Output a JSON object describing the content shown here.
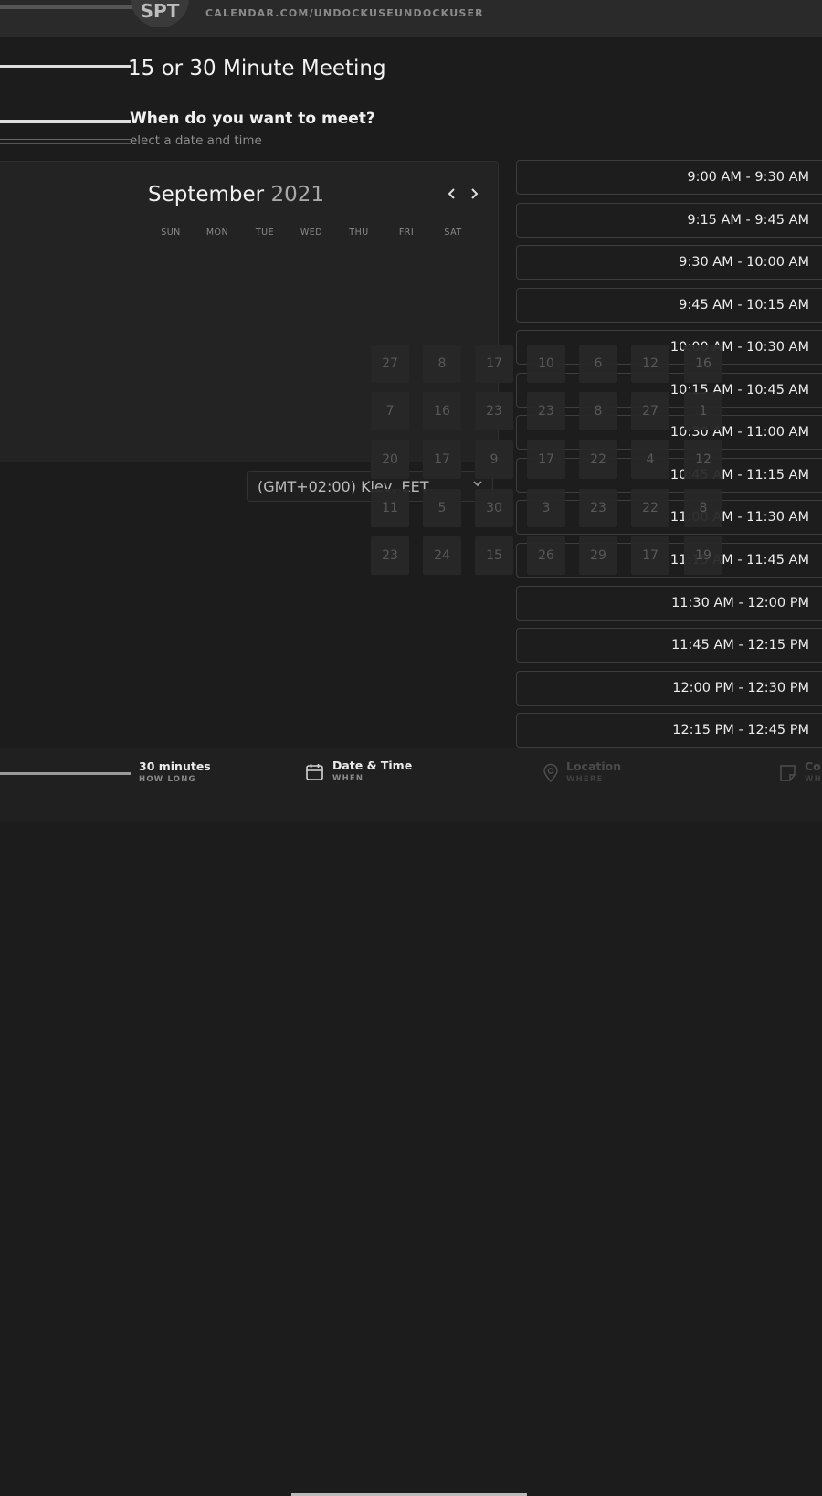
{
  "header": {
    "avatar_initials": "SPT",
    "calendar_url": "CALENDAR.COM/UNDOCKUSEUNDOCKUSER"
  },
  "meeting": {
    "title": "15 or 30 Minute Meeting"
  },
  "section": {
    "question": "When do you want to meet?",
    "subtitle": "elect a date and time"
  },
  "calendar": {
    "month": "September",
    "year": "2021",
    "prev_icon": "chevron-left-icon",
    "next_icon": "chevron-right-icon",
    "weekdays": [
      "SUN",
      "MON",
      "TUE",
      "WED",
      "THU",
      "FRI",
      "SAT"
    ],
    "days": [
      "27",
      "8",
      "17",
      "10",
      "6",
      "12",
      "16",
      "7",
      "16",
      "23",
      "23",
      "8",
      "27",
      "1",
      "20",
      "17",
      "9",
      "17",
      "22",
      "4",
      "12",
      "11",
      "5",
      "30",
      "3",
      "23",
      "22",
      "8",
      "23",
      "24",
      "15",
      "26",
      "29",
      "17",
      "19"
    ]
  },
  "timezone": {
    "label": "(GMT+02:00) Kiev, EET"
  },
  "time_slots": [
    "9:00 AM - 9:30 AM",
    "9:15 AM - 9:45 AM",
    "9:30 AM - 10:00 AM",
    "9:45 AM - 10:15 AM",
    "10:00 AM - 10:30 AM",
    "10:15 AM - 10:45 AM",
    "10:30 AM - 11:00 AM",
    "10:45 AM - 11:15 AM",
    "11:00 AM - 11:30 AM",
    "11:15 AM - 11:45 AM",
    "11:30 AM - 12:00 PM",
    "11:45 AM - 12:15 PM",
    "12:00 PM - 12:30 PM",
    "12:15 PM - 12:45 PM"
  ],
  "footer": {
    "duration": {
      "label": "30 minutes",
      "sub": "HOW LONG"
    },
    "datetime": {
      "label": "Date & Time",
      "sub": "WHEN",
      "icon": "calendar-icon"
    },
    "location": {
      "label": "Location",
      "sub": "WHERE",
      "icon": "location-pin-icon"
    },
    "confirm": {
      "label": "Co",
      "sub": "WH",
      "icon": "note-icon"
    }
  },
  "colors": {
    "background": "#1c1c1c",
    "panel": "#232323",
    "slot_border": "#3d3d3d",
    "text": "#e9e9e9"
  }
}
